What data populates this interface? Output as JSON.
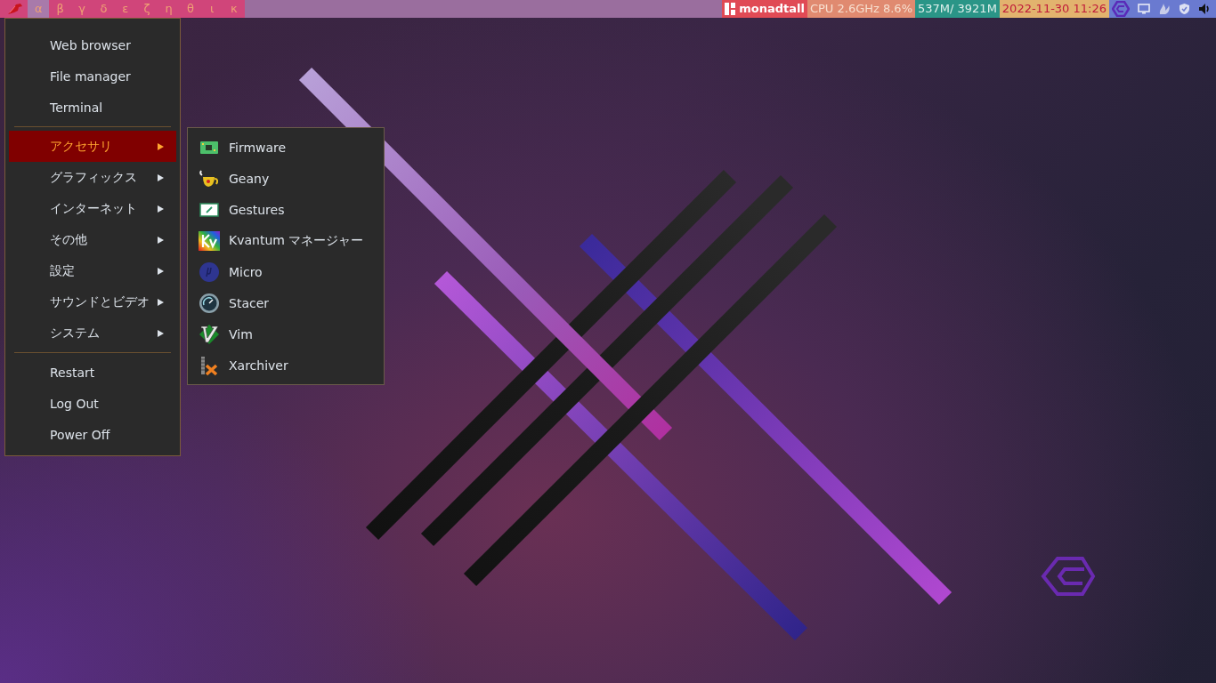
{
  "top_bar": {
    "workspaces": [
      {
        "label": "α",
        "selected": true
      },
      {
        "label": "β",
        "selected": false
      },
      {
        "label": "γ",
        "selected": false
      },
      {
        "label": "δ",
        "selected": false
      },
      {
        "label": "ε",
        "selected": false
      },
      {
        "label": "ζ",
        "selected": false
      },
      {
        "label": "η",
        "selected": false
      },
      {
        "label": "θ",
        "selected": false
      },
      {
        "label": "ι",
        "selected": false
      },
      {
        "label": "κ",
        "selected": false
      }
    ],
    "layout": "monadtall",
    "cpu": "CPU 2.6GHz 8.6%",
    "memory": "537M/ 3921M",
    "clock": "2022-11-30 11:26"
  },
  "main_menu": {
    "sections": [
      {
        "items": [
          {
            "label": "Web browser",
            "kind": "launcher",
            "selected": false
          },
          {
            "label": "File manager",
            "kind": "launcher",
            "selected": false
          },
          {
            "label": "Terminal",
            "kind": "launcher",
            "selected": false
          }
        ]
      },
      {
        "items": [
          {
            "label": "アクセサリ",
            "kind": "submenu",
            "selected": true
          },
          {
            "label": "グラフィックス",
            "kind": "submenu",
            "selected": false
          },
          {
            "label": "インターネット",
            "kind": "submenu",
            "selected": false
          },
          {
            "label": "その他",
            "kind": "submenu",
            "selected": false
          },
          {
            "label": "設定",
            "kind": "submenu",
            "selected": false
          },
          {
            "label": "サウンドとビデオ",
            "kind": "submenu",
            "selected": false
          },
          {
            "label": "システム",
            "kind": "submenu",
            "selected": false
          }
        ]
      },
      {
        "items": [
          {
            "label": "Restart",
            "kind": "launcher",
            "selected": false
          },
          {
            "label": "Log Out",
            "kind": "launcher",
            "selected": false
          },
          {
            "label": "Power Off",
            "kind": "launcher",
            "selected": false
          }
        ]
      }
    ]
  },
  "submenu": {
    "items": [
      {
        "label": "Firmware"
      },
      {
        "label": "Geany"
      },
      {
        "label": "Gestures"
      },
      {
        "label": "Kvantum マネージャー"
      },
      {
        "label": "Micro"
      },
      {
        "label": "Stacer"
      },
      {
        "label": "Vim"
      },
      {
        "label": "Xarchiver"
      }
    ]
  }
}
